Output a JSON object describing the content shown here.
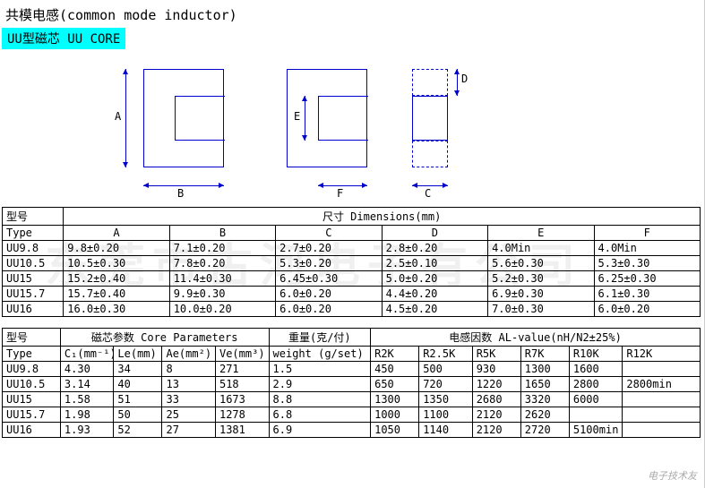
{
  "title": "共模电感(common mode inductor)",
  "subtitle": "UU型磁芯  UU CORE",
  "watermark": "东莞市古河电子有公司",
  "corner_mark": "电子技术友",
  "dim_labels": {
    "A": "A",
    "B": "B",
    "E": "E",
    "F": "F",
    "C": "C",
    "D": "D"
  },
  "table1": {
    "head_type": "型号",
    "head_type_en": "Type",
    "head_dim": "尺寸 Dimensions(mm)",
    "cols": [
      "A",
      "B",
      "C",
      "D",
      "E",
      "F"
    ],
    "rows": [
      {
        "type": "UU9.8",
        "A": "9.8±0.20",
        "B": "7.1±0.20",
        "C": "2.7±0.20",
        "D": "2.8±0.20",
        "E": "4.0Min",
        "F": "4.0Min"
      },
      {
        "type": "UU10.5",
        "A": "10.5±0.30",
        "B": "7.8±0.20",
        "C": "5.3±0.20",
        "D": "2.5±0.10",
        "E": "5.6±0.30",
        "F": "5.3±0.30"
      },
      {
        "type": "UU15",
        "A": "15.2±0.40",
        "B": "11.4±0.30",
        "C": "6.45±0.30",
        "D": "5.0±0.20",
        "E": "5.2±0.30",
        "F": "6.25±0.30"
      },
      {
        "type": "UU15.7",
        "A": "15.7±0.40",
        "B": "9.9±0.30",
        "C": "6.0±0.20",
        "D": "4.4±0.20",
        "E": "6.9±0.30",
        "F": "6.1±0.30"
      },
      {
        "type": "UU16",
        "A": "16.0±0.30",
        "B": "10.0±0.20",
        "C": "6.0±0.20",
        "D": "4.5±0.20",
        "E": "7.0±0.30",
        "F": "6.0±0.20"
      }
    ]
  },
  "table2": {
    "head_type": "型号",
    "head_type_en": "Type",
    "head_core": "磁芯参数 Core Parameters",
    "head_weight": "重量(克/付)",
    "head_weight_en": "weight (g/set)",
    "head_al": "电感因数 AL-value(nH/N2±25%)",
    "core_cols": [
      "C₁(mm⁻¹)",
      "Le(mm)",
      "Ae(mm²)",
      "Ve(mm³)"
    ],
    "al_cols": [
      "R2K",
      "R2.5K",
      "R5K",
      "R7K",
      "R10K",
      "R12K"
    ],
    "rows": [
      {
        "type": "UU9.8",
        "C1": "4.30",
        "Le": "34",
        "Ae": "8",
        "Ve": "271",
        "wt": "1.5",
        "al": [
          "450",
          "500",
          "930",
          "1300",
          "1600",
          ""
        ]
      },
      {
        "type": "UU10.5",
        "C1": "3.14",
        "Le": "40",
        "Ae": "13",
        "Ve": "518",
        "wt": "2.9",
        "al": [
          "650",
          "720",
          "1220",
          "1650",
          "2800",
          "2800min"
        ]
      },
      {
        "type": "UU15",
        "C1": "1.58",
        "Le": "51",
        "Ae": "33",
        "Ve": "1673",
        "wt": "8.8",
        "al": [
          "1300",
          "1350",
          "2680",
          "3320",
          "6000",
          ""
        ]
      },
      {
        "type": "UU15.7",
        "C1": "1.98",
        "Le": "50",
        "Ae": "25",
        "Ve": "1278",
        "wt": "6.8",
        "al": [
          "1000",
          "1100",
          "2120",
          "2620",
          "",
          ""
        ]
      },
      {
        "type": "UU16",
        "C1": "1.93",
        "Le": "52",
        "Ae": "27",
        "Ve": "1381",
        "wt": "6.9",
        "al": [
          "1050",
          "1140",
          "2120",
          "2720",
          "5100min",
          ""
        ]
      }
    ]
  }
}
